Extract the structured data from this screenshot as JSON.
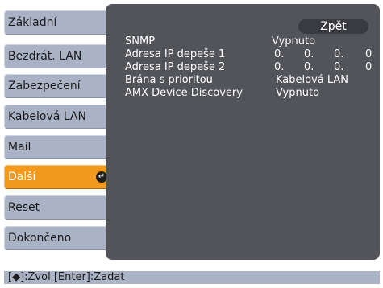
{
  "menu": {
    "items": [
      {
        "label": "Základní"
      },
      {
        "label": "Bezdrát. LAN"
      },
      {
        "label": "Zabezpečení"
      },
      {
        "label": "Kabelová LAN"
      },
      {
        "label": "Mail"
      },
      {
        "label": "Další",
        "active": true
      },
      {
        "label": "Reset"
      },
      {
        "label": "Dokončeno"
      }
    ],
    "active_icon": "enter-icon"
  },
  "panel": {
    "back_label": "Zpět",
    "rows": [
      {
        "label": "SNMP",
        "value": "Vypnuto"
      },
      {
        "label": "Adresa IP depeše 1",
        "octets": [
          "0.",
          "0.",
          "0.",
          "0"
        ]
      },
      {
        "label": "Adresa IP depeše 2",
        "octets": [
          "0.",
          "0.",
          "0.",
          "0"
        ]
      },
      {
        "label": "Brána s prioritou",
        "value": "Kabelová LAN"
      },
      {
        "label": "AMX Device Discovery",
        "value": "Vypnuto"
      }
    ]
  },
  "status_bar": {
    "text": "[◆]:Zvol  [Enter]:Zadat"
  },
  "colors": {
    "menu_bg": "#aab2c6",
    "active_bg": "#f39a1e",
    "panel_bg": "#52545a"
  }
}
